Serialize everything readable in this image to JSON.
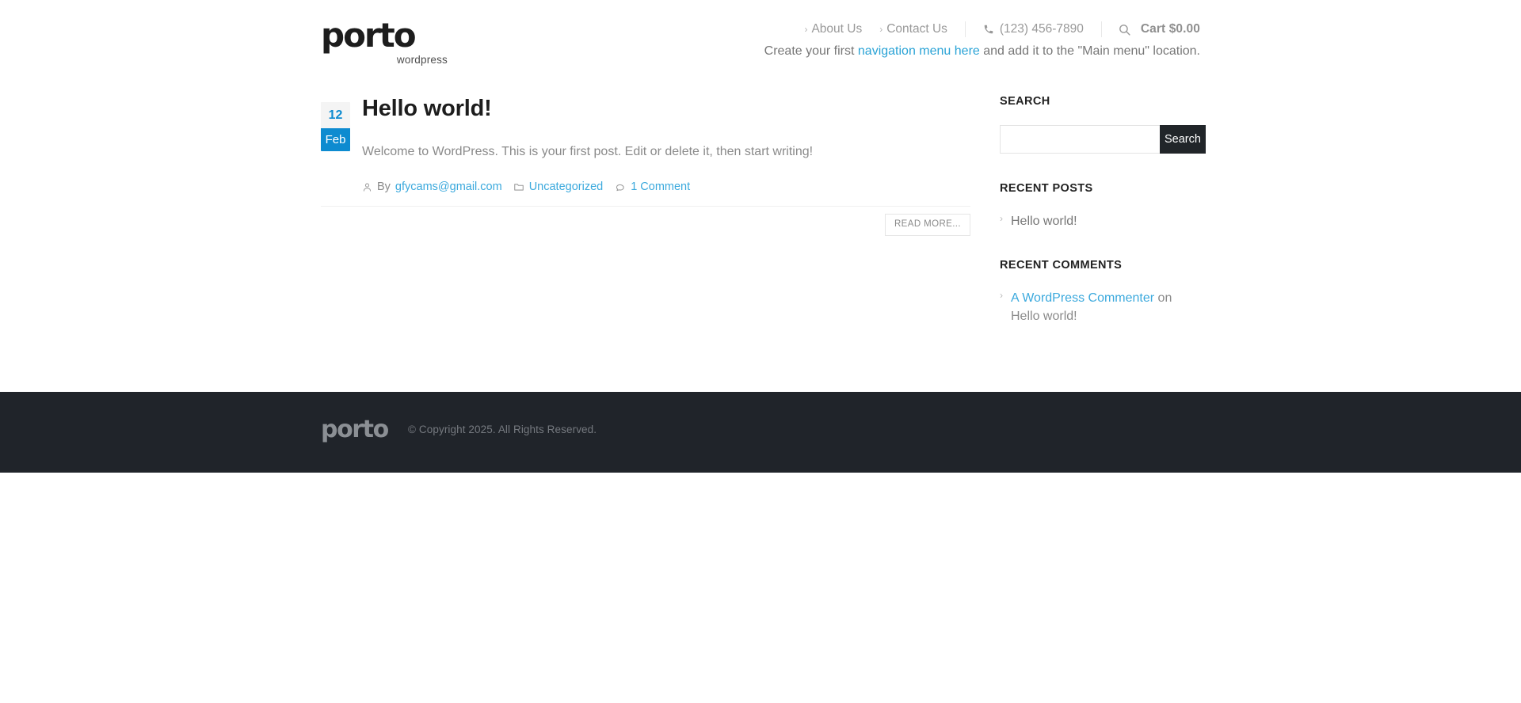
{
  "header": {
    "logo": {
      "word": "porto",
      "sub": "wordpress"
    },
    "topnav": [
      {
        "label": "About Us",
        "icon": "chevron-right-icon"
      },
      {
        "label": "Contact Us",
        "icon": "chevron-right-icon"
      }
    ],
    "phone": {
      "icon": "phone-icon",
      "number": "(123) 456-7890"
    },
    "search_icon": "search-icon",
    "cart": {
      "label": "Cart $0.00"
    },
    "menu_notice": {
      "prefix": "Create your first ",
      "link": "navigation menu here",
      "suffix": " and add it to the \"Main menu\" location."
    }
  },
  "post": {
    "date": {
      "day": "12",
      "month": "Feb"
    },
    "title": "Hello world!",
    "excerpt": "Welcome to WordPress. This is your first post. Edit or delete it, then start writing!",
    "meta": {
      "by_label": "By",
      "author": "gfycams@gmail.com",
      "author_icon": "user-icon",
      "category": "Uncategorized",
      "category_icon": "folder-icon",
      "comments": "1 Comment",
      "comments_icon": "comment-icon"
    },
    "read_more": "READ MORE..."
  },
  "sidebar": {
    "search": {
      "title": "SEARCH",
      "input_value": "",
      "placeholder": "",
      "button": "Search"
    },
    "recent_posts": {
      "title": "RECENT POSTS",
      "items": [
        {
          "label": "Hello world!"
        }
      ]
    },
    "recent_comments": {
      "title": "RECENT COMMENTS",
      "items": [
        {
          "author": "A WordPress Commenter",
          "connector": " on ",
          "post": "Hello world!"
        }
      ]
    }
  },
  "footer": {
    "logo": "porto",
    "copyright": "© Copyright 2025. All Rights Reserved."
  },
  "colors": {
    "accent_blue": "#0d8bd0",
    "link_blue": "#3ba9dd",
    "dark": "#212529",
    "footer_bg": "#20242a"
  }
}
